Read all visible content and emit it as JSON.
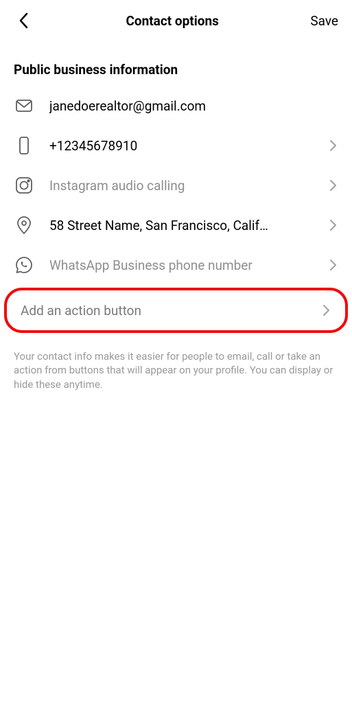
{
  "header": {
    "title": "Contact options",
    "save_label": "Save"
  },
  "section_heading": "Public business information",
  "rows": {
    "email": "janedoerealtor@gmail.com",
    "phone": "+12345678910",
    "ig_calling_placeholder": "Instagram audio calling",
    "address": "58 Street Name, San Francisco, Calif…",
    "whatsapp_placeholder": "WhatsApp Business phone number"
  },
  "action_button_label": "Add an action button",
  "footer_info": "Your contact info makes it easier for people to email, call or take an action from buttons that will appear on your profile. You can display or hide these anytime."
}
